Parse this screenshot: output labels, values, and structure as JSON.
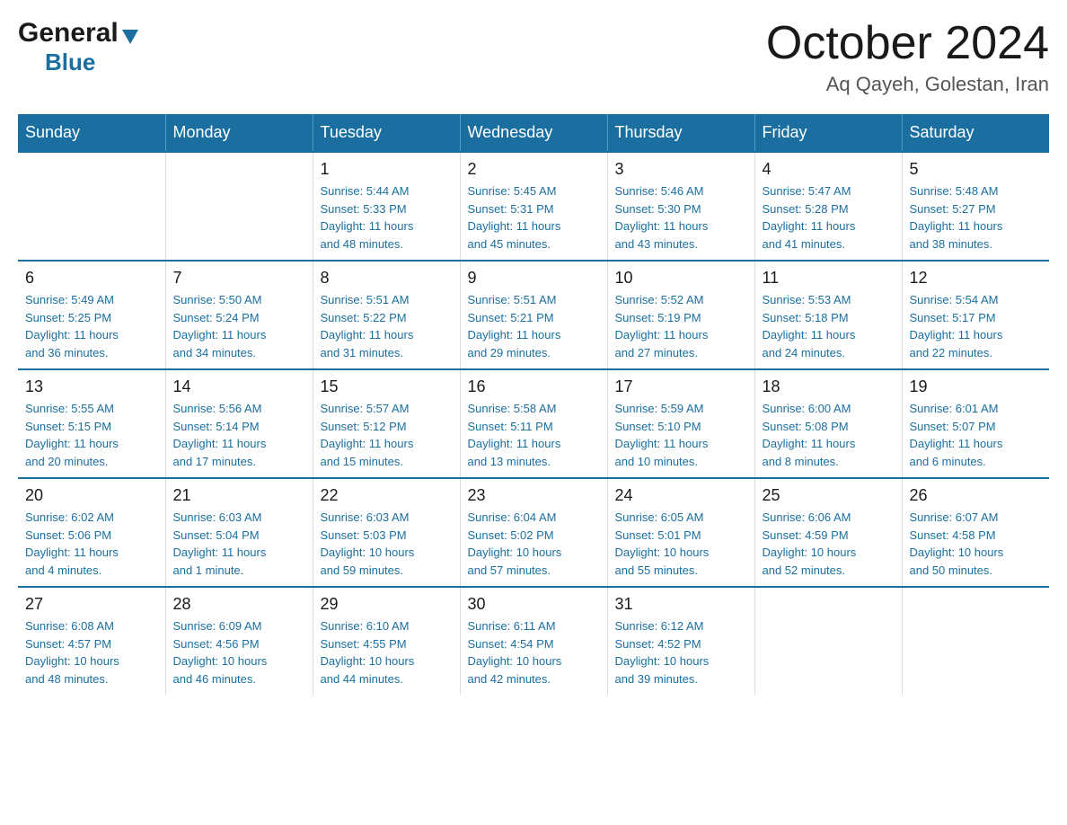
{
  "header": {
    "logo": {
      "general": "General",
      "triangle": "▲",
      "blue": "Blue"
    },
    "title": "October 2024",
    "location": "Aq Qayeh, Golestan, Iran"
  },
  "days_of_week": [
    "Sunday",
    "Monday",
    "Tuesday",
    "Wednesday",
    "Thursday",
    "Friday",
    "Saturday"
  ],
  "weeks": [
    [
      {
        "day": "",
        "info": ""
      },
      {
        "day": "",
        "info": ""
      },
      {
        "day": "1",
        "info": "Sunrise: 5:44 AM\nSunset: 5:33 PM\nDaylight: 11 hours\nand 48 minutes."
      },
      {
        "day": "2",
        "info": "Sunrise: 5:45 AM\nSunset: 5:31 PM\nDaylight: 11 hours\nand 45 minutes."
      },
      {
        "day": "3",
        "info": "Sunrise: 5:46 AM\nSunset: 5:30 PM\nDaylight: 11 hours\nand 43 minutes."
      },
      {
        "day": "4",
        "info": "Sunrise: 5:47 AM\nSunset: 5:28 PM\nDaylight: 11 hours\nand 41 minutes."
      },
      {
        "day": "5",
        "info": "Sunrise: 5:48 AM\nSunset: 5:27 PM\nDaylight: 11 hours\nand 38 minutes."
      }
    ],
    [
      {
        "day": "6",
        "info": "Sunrise: 5:49 AM\nSunset: 5:25 PM\nDaylight: 11 hours\nand 36 minutes."
      },
      {
        "day": "7",
        "info": "Sunrise: 5:50 AM\nSunset: 5:24 PM\nDaylight: 11 hours\nand 34 minutes."
      },
      {
        "day": "8",
        "info": "Sunrise: 5:51 AM\nSunset: 5:22 PM\nDaylight: 11 hours\nand 31 minutes."
      },
      {
        "day": "9",
        "info": "Sunrise: 5:51 AM\nSunset: 5:21 PM\nDaylight: 11 hours\nand 29 minutes."
      },
      {
        "day": "10",
        "info": "Sunrise: 5:52 AM\nSunset: 5:19 PM\nDaylight: 11 hours\nand 27 minutes."
      },
      {
        "day": "11",
        "info": "Sunrise: 5:53 AM\nSunset: 5:18 PM\nDaylight: 11 hours\nand 24 minutes."
      },
      {
        "day": "12",
        "info": "Sunrise: 5:54 AM\nSunset: 5:17 PM\nDaylight: 11 hours\nand 22 minutes."
      }
    ],
    [
      {
        "day": "13",
        "info": "Sunrise: 5:55 AM\nSunset: 5:15 PM\nDaylight: 11 hours\nand 20 minutes."
      },
      {
        "day": "14",
        "info": "Sunrise: 5:56 AM\nSunset: 5:14 PM\nDaylight: 11 hours\nand 17 minutes."
      },
      {
        "day": "15",
        "info": "Sunrise: 5:57 AM\nSunset: 5:12 PM\nDaylight: 11 hours\nand 15 minutes."
      },
      {
        "day": "16",
        "info": "Sunrise: 5:58 AM\nSunset: 5:11 PM\nDaylight: 11 hours\nand 13 minutes."
      },
      {
        "day": "17",
        "info": "Sunrise: 5:59 AM\nSunset: 5:10 PM\nDaylight: 11 hours\nand 10 minutes."
      },
      {
        "day": "18",
        "info": "Sunrise: 6:00 AM\nSunset: 5:08 PM\nDaylight: 11 hours\nand 8 minutes."
      },
      {
        "day": "19",
        "info": "Sunrise: 6:01 AM\nSunset: 5:07 PM\nDaylight: 11 hours\nand 6 minutes."
      }
    ],
    [
      {
        "day": "20",
        "info": "Sunrise: 6:02 AM\nSunset: 5:06 PM\nDaylight: 11 hours\nand 4 minutes."
      },
      {
        "day": "21",
        "info": "Sunrise: 6:03 AM\nSunset: 5:04 PM\nDaylight: 11 hours\nand 1 minute."
      },
      {
        "day": "22",
        "info": "Sunrise: 6:03 AM\nSunset: 5:03 PM\nDaylight: 10 hours\nand 59 minutes."
      },
      {
        "day": "23",
        "info": "Sunrise: 6:04 AM\nSunset: 5:02 PM\nDaylight: 10 hours\nand 57 minutes."
      },
      {
        "day": "24",
        "info": "Sunrise: 6:05 AM\nSunset: 5:01 PM\nDaylight: 10 hours\nand 55 minutes."
      },
      {
        "day": "25",
        "info": "Sunrise: 6:06 AM\nSunset: 4:59 PM\nDaylight: 10 hours\nand 52 minutes."
      },
      {
        "day": "26",
        "info": "Sunrise: 6:07 AM\nSunset: 4:58 PM\nDaylight: 10 hours\nand 50 minutes."
      }
    ],
    [
      {
        "day": "27",
        "info": "Sunrise: 6:08 AM\nSunset: 4:57 PM\nDaylight: 10 hours\nand 48 minutes."
      },
      {
        "day": "28",
        "info": "Sunrise: 6:09 AM\nSunset: 4:56 PM\nDaylight: 10 hours\nand 46 minutes."
      },
      {
        "day": "29",
        "info": "Sunrise: 6:10 AM\nSunset: 4:55 PM\nDaylight: 10 hours\nand 44 minutes."
      },
      {
        "day": "30",
        "info": "Sunrise: 6:11 AM\nSunset: 4:54 PM\nDaylight: 10 hours\nand 42 minutes."
      },
      {
        "day": "31",
        "info": "Sunrise: 6:12 AM\nSunset: 4:52 PM\nDaylight: 10 hours\nand 39 minutes."
      },
      {
        "day": "",
        "info": ""
      },
      {
        "day": "",
        "info": ""
      }
    ]
  ]
}
